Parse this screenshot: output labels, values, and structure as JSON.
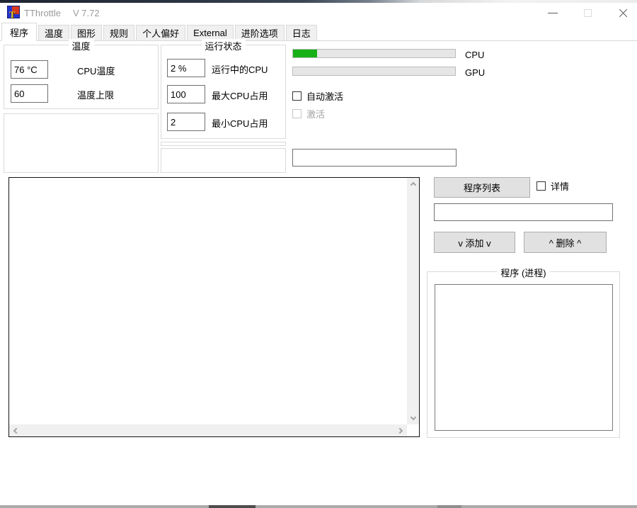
{
  "window": {
    "icon_letter": "T",
    "title": "TThrottle",
    "version": "V 7.72"
  },
  "tabs": [
    {
      "label": "程序",
      "active": true
    },
    {
      "label": "温度",
      "active": false
    },
    {
      "label": "图形",
      "active": false
    },
    {
      "label": "规则",
      "active": false
    },
    {
      "label": "个人偏好",
      "active": false
    },
    {
      "label": "External",
      "active": false
    },
    {
      "label": "进阶选项",
      "active": false
    },
    {
      "label": "日志",
      "active": false
    }
  ],
  "temperature_group": {
    "title": "温度",
    "cpu_temp": {
      "value": "76 °C",
      "label": "CPU温度"
    },
    "temp_limit": {
      "value": "60",
      "label": "温度上限"
    }
  },
  "status_group": {
    "title": "运行状态",
    "running_cpu": {
      "value": "2 %",
      "label": "运行中的CPU"
    },
    "max_cpu": {
      "value": "100",
      "label": "最大CPU占用"
    },
    "min_cpu": {
      "value": "2",
      "label": "最小CPU占用"
    }
  },
  "meters": {
    "cpu": {
      "label": "CPU",
      "percent": 15,
      "color": "#17b117"
    },
    "gpu": {
      "label": "GPU",
      "percent": 0
    }
  },
  "options": {
    "auto_activate": {
      "label": "自动激活",
      "checked": false,
      "disabled": false
    },
    "activate": {
      "label": "激活",
      "checked": false,
      "disabled": true
    }
  },
  "threshold_input": {
    "value": ""
  },
  "main_list": {
    "items": []
  },
  "program_panel": {
    "list_button": "程序列表",
    "details_checkbox": {
      "label": "详情",
      "checked": false
    },
    "name_input": {
      "value": ""
    },
    "add_button": "v 添加 v",
    "remove_button": "^ 删除 ^",
    "process_group": {
      "title": "程序 (进程)",
      "items": []
    }
  },
  "colors": {
    "progress_green": "#17b117",
    "button_face": "#e1e1e1",
    "scrollbar_track": "#f0f0f0"
  }
}
